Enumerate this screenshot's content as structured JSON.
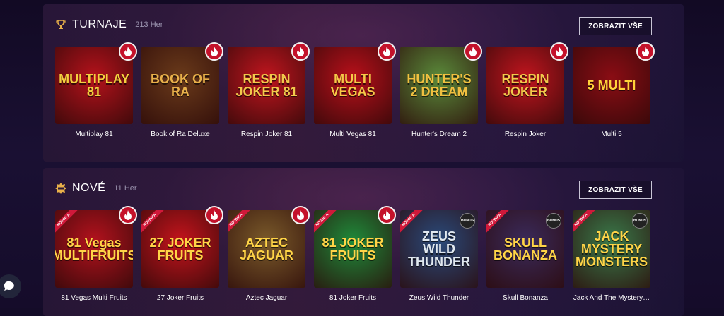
{
  "sections": [
    {
      "title": "TURNAJE",
      "count": "213 Her",
      "icon": "trophy-icon",
      "show_all": "ZOBRAZIT VŠE",
      "games": [
        {
          "name": "Multiplay 81",
          "logo": "MULTIPLAY 81",
          "bg": "#b5121b",
          "fg": "#f4d03f",
          "hot": true
        },
        {
          "name": "Book of Ra Deluxe",
          "logo": "BOOK OF RA",
          "bg": "#6a3a1a",
          "fg": "#e8b04a",
          "hot": true
        },
        {
          "name": "Respin Joker 81",
          "logo": "RESPIN JOKER 81",
          "bg": "#c0151e",
          "fg": "#f2c94c",
          "hot": true
        },
        {
          "name": "Multi Vegas 81",
          "logo": "MULTI VEGAS",
          "bg": "#b8101a",
          "fg": "#f7c948",
          "hot": true
        },
        {
          "name": "Hunter's Dream 2",
          "logo": "HUNTER'S 2 DREAM",
          "bg": "#5a8a3a",
          "fg": "#f0c040",
          "hot": true
        },
        {
          "name": "Respin Joker",
          "logo": "RESPIN JOKER",
          "bg": "#c0151e",
          "fg": "#f2c94c",
          "hot": true
        },
        {
          "name": "Multi 5",
          "logo": "5 MULTI",
          "bg": "#8a0d14",
          "fg": "#ffd23a",
          "hot": true
        }
      ]
    },
    {
      "title": "NOVÉ",
      "count": "11 Her",
      "icon": "new-badge-icon",
      "show_all": "ZOBRAZIT VŠE",
      "ribbon": "NOVINKA",
      "bonus": "BONUS",
      "games": [
        {
          "name": "81 Vegas Multi Fruits",
          "logo": "81 Vegas MULTIFRUITS",
          "bg": "#b3121d",
          "fg": "#ffd447",
          "hot": true,
          "bonus": false
        },
        {
          "name": "27 Joker Fruits",
          "logo": "27 JOKER FRUITS",
          "bg": "#c4141c",
          "fg": "#ffd447",
          "hot": true,
          "bonus": false
        },
        {
          "name": "Aztec Jaguar",
          "logo": "AZTEC JAGUAR",
          "bg": "#7a5a2a",
          "fg": "#ffd447",
          "hot": true,
          "bonus": false
        },
        {
          "name": "81 Joker Fruits",
          "logo": "81 JOKER FRUITS",
          "bg": "#1f8a3a",
          "fg": "#ffd447",
          "hot": true,
          "bonus": false
        },
        {
          "name": "Zeus Wild Thunder",
          "logo": "ZEUS WILD THUNDER",
          "bg": "#2a4a7a",
          "fg": "#e0e8f0",
          "hot": false,
          "bonus": true
        },
        {
          "name": "Skull Bonanza",
          "logo": "SKULL BONANZA",
          "bg": "#3a2a5a",
          "fg": "#ffd447",
          "hot": false,
          "bonus": true
        },
        {
          "name": "Jack And The Mystery…",
          "logo": "JACK MYSTERY MONSTERS",
          "bg": "#3a7a4a",
          "fg": "#ffd447",
          "hot": false,
          "bonus": true
        }
      ]
    }
  ],
  "colors": {
    "hot_badge": "#c4122b",
    "ribbon": "#d0193a",
    "text": "#ffffff",
    "muted": "#9c95b0"
  }
}
